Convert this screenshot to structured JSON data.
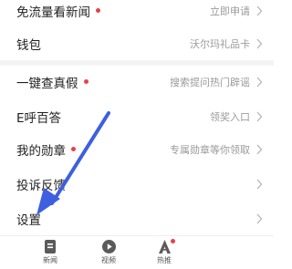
{
  "menu": {
    "items": [
      {
        "label": "免流量看新闻",
        "hint": "立即申请",
        "dot": true
      },
      {
        "label": "钱包",
        "hint": "沃尔玛礼品卡",
        "dot": false
      },
      {
        "label": "一键查真假",
        "hint": "搜索提问热门辟谣",
        "dot": true
      },
      {
        "label": "E呼百答",
        "hint": "领奖入口",
        "dot": false
      },
      {
        "label": "我的勋章",
        "hint": "专属勋章等你领取",
        "dot": true
      },
      {
        "label": "投诉反馈",
        "hint": "",
        "dot": false
      },
      {
        "label": "设置",
        "hint": "",
        "dot": false
      }
    ]
  },
  "tabbar": {
    "tabs": [
      {
        "label": "新闻",
        "icon": "news-icon"
      },
      {
        "label": "视频",
        "icon": "video-play-icon"
      },
      {
        "label": "热推",
        "icon": "hot-push-icon",
        "badge": true
      }
    ]
  },
  "colors": {
    "badge_dot": "#e8404a",
    "arrow": "#3d5fe0"
  }
}
